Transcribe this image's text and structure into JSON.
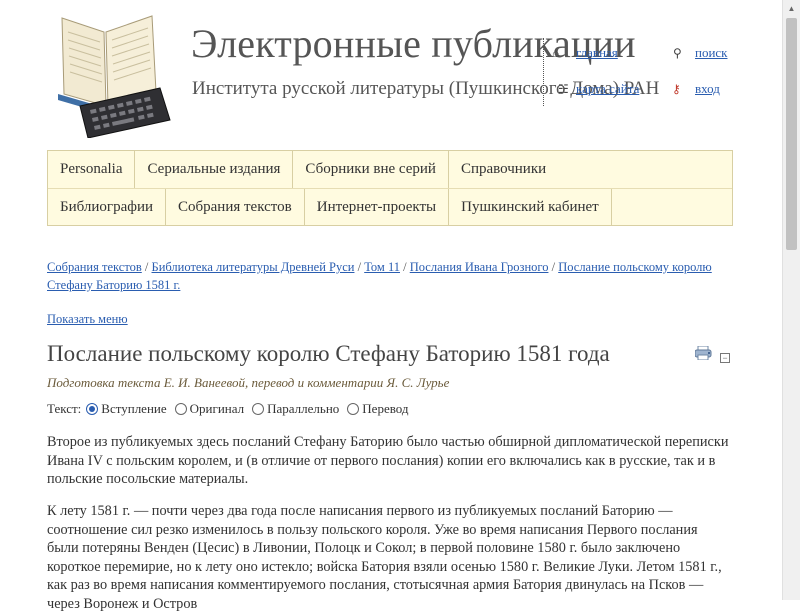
{
  "header": {
    "title": "Электронные публикации",
    "subtitle": "Института русской литературы (Пушкинского Дома) РАН",
    "overlay_links": {
      "home": "главная",
      "search": "поиск",
      "sitemap": "карта сайта",
      "login": "вход"
    }
  },
  "menu": {
    "row1": [
      "Personalia",
      "Сериальные издания",
      "Сборники вне серий",
      "Справочники"
    ],
    "row2": [
      "Библиографии",
      "Собрания текстов",
      "Интернет-проекты",
      "Пушкинский кабинет"
    ]
  },
  "breadcrumb": [
    "Собрания текстов",
    "Библиотека литературы Древней Руси",
    "Том 11",
    "Послания Ивана Грозного",
    "Послание польскому королю Стефану Баторию 1581 г."
  ],
  "breadcrumb_separator": " / ",
  "show_menu_label": "Показать меню",
  "page": {
    "title": "Послание польскому королю Стефану Баторию 1581 года",
    "credits": "Подготовка текста Е. И. Ванеевой, перевод и комментарии Я. С. Лурье",
    "text_label": "Текст:",
    "text_options": [
      "Вступление",
      "Оригинал",
      "Параллельно",
      "Перевод"
    ],
    "text_selected": "Вступление",
    "paragraphs": [
      "Второе из публикуемых здесь посланий Стефану Баторию было частью обширной дипломатической переписки Ивана IV с польским королем, и (в отличие от первого послания) копии его включались как в русские, так и в польские посольские материалы.",
      "К лету 1581 г. — почти через два года после написания первого из публикуемых посланий Баторию — соотношение сил резко изменилось в пользу польского короля. Уже во время написания Первого послания были потеряны Венден (Цесис) в Ливонии, Полоцк и Сокол; в первой половине 1580 г. было заключено короткое перемирие, но к лету оно истекло; войска Батория взяли осенью 1580 г. Великие Луки. Летом 1581 г., как раз во время написания комментируемого послания, стотысячная армия Батория двинулась на Псков — через Воронеж и Остров"
    ]
  },
  "icons": {
    "print": "print-icon",
    "collapse": "collapse-icon",
    "search": "magnifier-icon",
    "login": "key-icon",
    "logo": "book-keyboard-logo"
  },
  "colors": {
    "link": "#2a5db0",
    "menu_bg": "#fffbe0",
    "menu_border": "#d8cfa3",
    "credits": "#6a5a3a"
  }
}
